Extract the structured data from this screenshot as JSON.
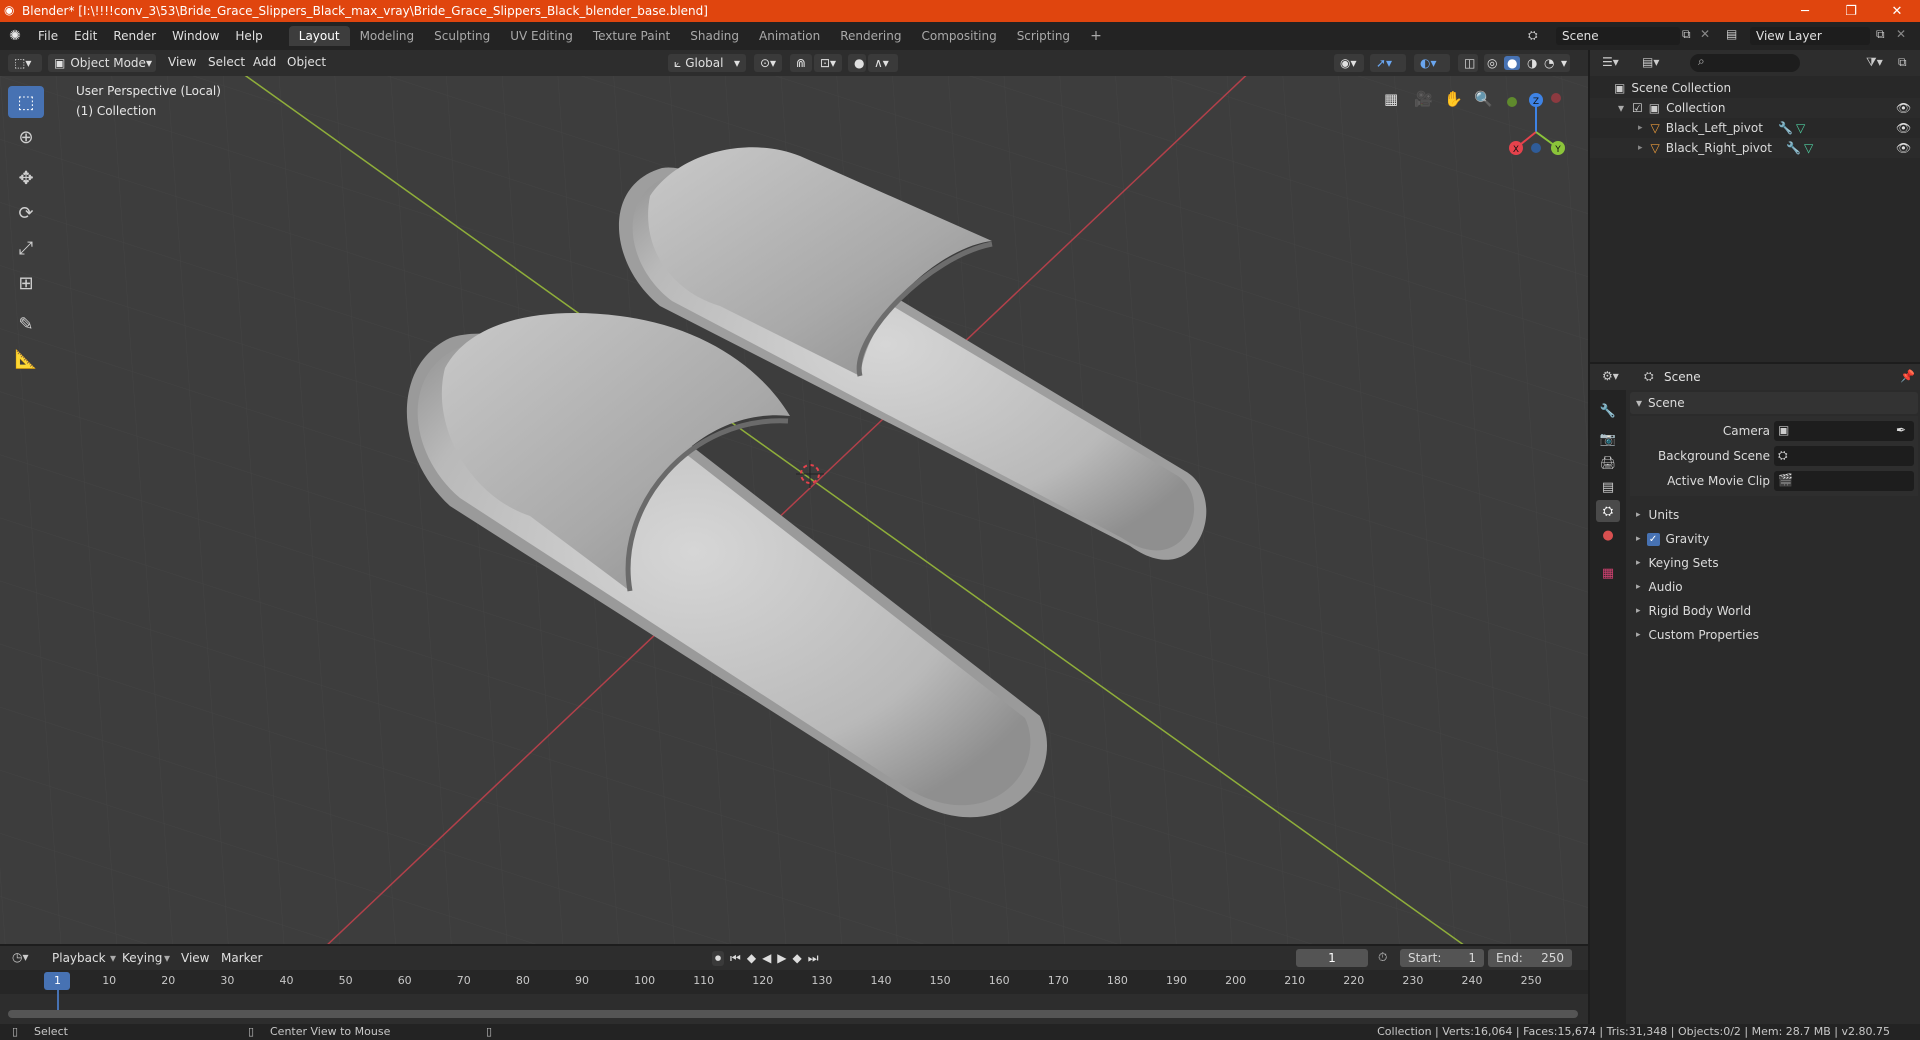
{
  "window": {
    "title": "Blender* [I:\\!!!!conv_3\\53\\Bride_Grace_Slippers_Black_max_vray\\Bride_Grace_Slippers_Black_blender_base.blend]",
    "controls": [
      "─",
      "❐",
      "✕"
    ]
  },
  "menu": {
    "items": [
      "File",
      "Edit",
      "Render",
      "Window",
      "Help"
    ]
  },
  "workspaces": [
    "Layout",
    "Modeling",
    "Sculpting",
    "UV Editing",
    "Texture Paint",
    "Shading",
    "Animation",
    "Rendering",
    "Compositing",
    "Scripting"
  ],
  "workspace_add": "+",
  "topright": {
    "scene": "Scene",
    "view_layer": "View Layer"
  },
  "viewport_header": {
    "mode": "Object Mode",
    "menus": [
      "View",
      "Select",
      "Add",
      "Object"
    ],
    "transform": "Global"
  },
  "viewport": {
    "perspective": "User Perspective (Local)",
    "collection": "(1) Collection",
    "gizmo": {
      "x": "X",
      "y": "Y",
      "z": "Z"
    }
  },
  "outliner": {
    "root": "Scene Collection",
    "collection": "Collection",
    "objects": [
      "Black_Left_pivot",
      "Black_Right_pivot"
    ]
  },
  "properties": {
    "header": "Scene",
    "panel": "Scene",
    "fields": [
      {
        "label": "Camera"
      },
      {
        "label": "Background Scene"
      },
      {
        "label": "Active Movie Clip"
      }
    ],
    "sections": [
      "Units",
      "Gravity",
      "Keying Sets",
      "Audio",
      "Rigid Body World",
      "Custom Properties"
    ]
  },
  "timeline": {
    "menus": [
      "Playback",
      "Keying",
      "View",
      "Marker"
    ],
    "current_frame": "1",
    "start_label": "Start:",
    "start": "1",
    "end_label": "End:",
    "end": "250",
    "ticks": [
      "1",
      "10",
      "20",
      "30",
      "40",
      "50",
      "60",
      "70",
      "80",
      "90",
      "100",
      "110",
      "120",
      "130",
      "140",
      "150",
      "160",
      "170",
      "180",
      "190",
      "200",
      "210",
      "220",
      "230",
      "240",
      "250"
    ]
  },
  "statusbar": {
    "left": "Select",
    "middle": "Center View to Mouse",
    "stats": "Collection | Verts:16,064 | Faces:15,674 | Tris:31,348 | Objects:0/2 | Mem: 28.7 MB | v2.80.75"
  },
  "colors": {
    "titlebar": "#e0450e",
    "accent": "#4772b3",
    "x_axis": "#e5424c",
    "y_axis": "#8bc43a",
    "z_axis": "#3e83e5",
    "object_orange": "#e89a3b"
  }
}
